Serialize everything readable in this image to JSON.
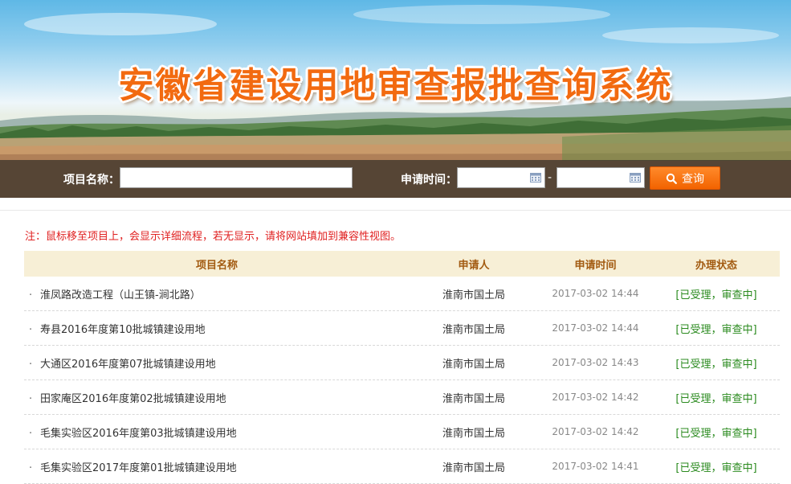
{
  "header": {
    "title": "安徽省建设用地审查报批查询系统"
  },
  "search": {
    "name_label": "项目名称：",
    "name_value": "",
    "date_label": "申请时间：",
    "date_from": "",
    "date_to": "",
    "date_separator": "-",
    "button_label": "查询"
  },
  "notice": "注：鼠标移至项目上，会显示详细流程，若无显示，请将网站填加到兼容性视图。",
  "table": {
    "columns": [
      "项目名称",
      "申请人",
      "申请时间",
      "办理状态"
    ],
    "rows": [
      {
        "name": "淮凤路改造工程（山王镇-涧北路）",
        "applicant": "淮南市国土局",
        "time": "2017-03-02 14:44",
        "status": "[已受理，审查中]"
      },
      {
        "name": "寿县2016年度第10批城镇建设用地",
        "applicant": "淮南市国土局",
        "time": "2017-03-02 14:44",
        "status": "[已受理，审查中]"
      },
      {
        "name": "大通区2016年度第07批城镇建设用地",
        "applicant": "淮南市国土局",
        "time": "2017-03-02 14:43",
        "status": "[已受理，审查中]"
      },
      {
        "name": "田家庵区2016年度第02批城镇建设用地",
        "applicant": "淮南市国土局",
        "time": "2017-03-02 14:42",
        "status": "[已受理，审查中]"
      },
      {
        "name": "毛集实验区2016年度第03批城镇建设用地",
        "applicant": "淮南市国土局",
        "time": "2017-03-02 14:42",
        "status": "[已受理，审查中]"
      },
      {
        "name": "毛集实验区2017年度第01批城镇建设用地",
        "applicant": "淮南市国土局",
        "time": "2017-03-02 14:41",
        "status": "[已受理，审查中]"
      }
    ]
  },
  "icons": {
    "calendar": "calendar-icon",
    "search": "search-icon"
  },
  "colors": {
    "title": "#f26a10",
    "button": "#f26300",
    "notice": "#e02020",
    "status": "#2a8a1e",
    "header_bg": "#f7efd6",
    "header_text": "#a25a10"
  }
}
